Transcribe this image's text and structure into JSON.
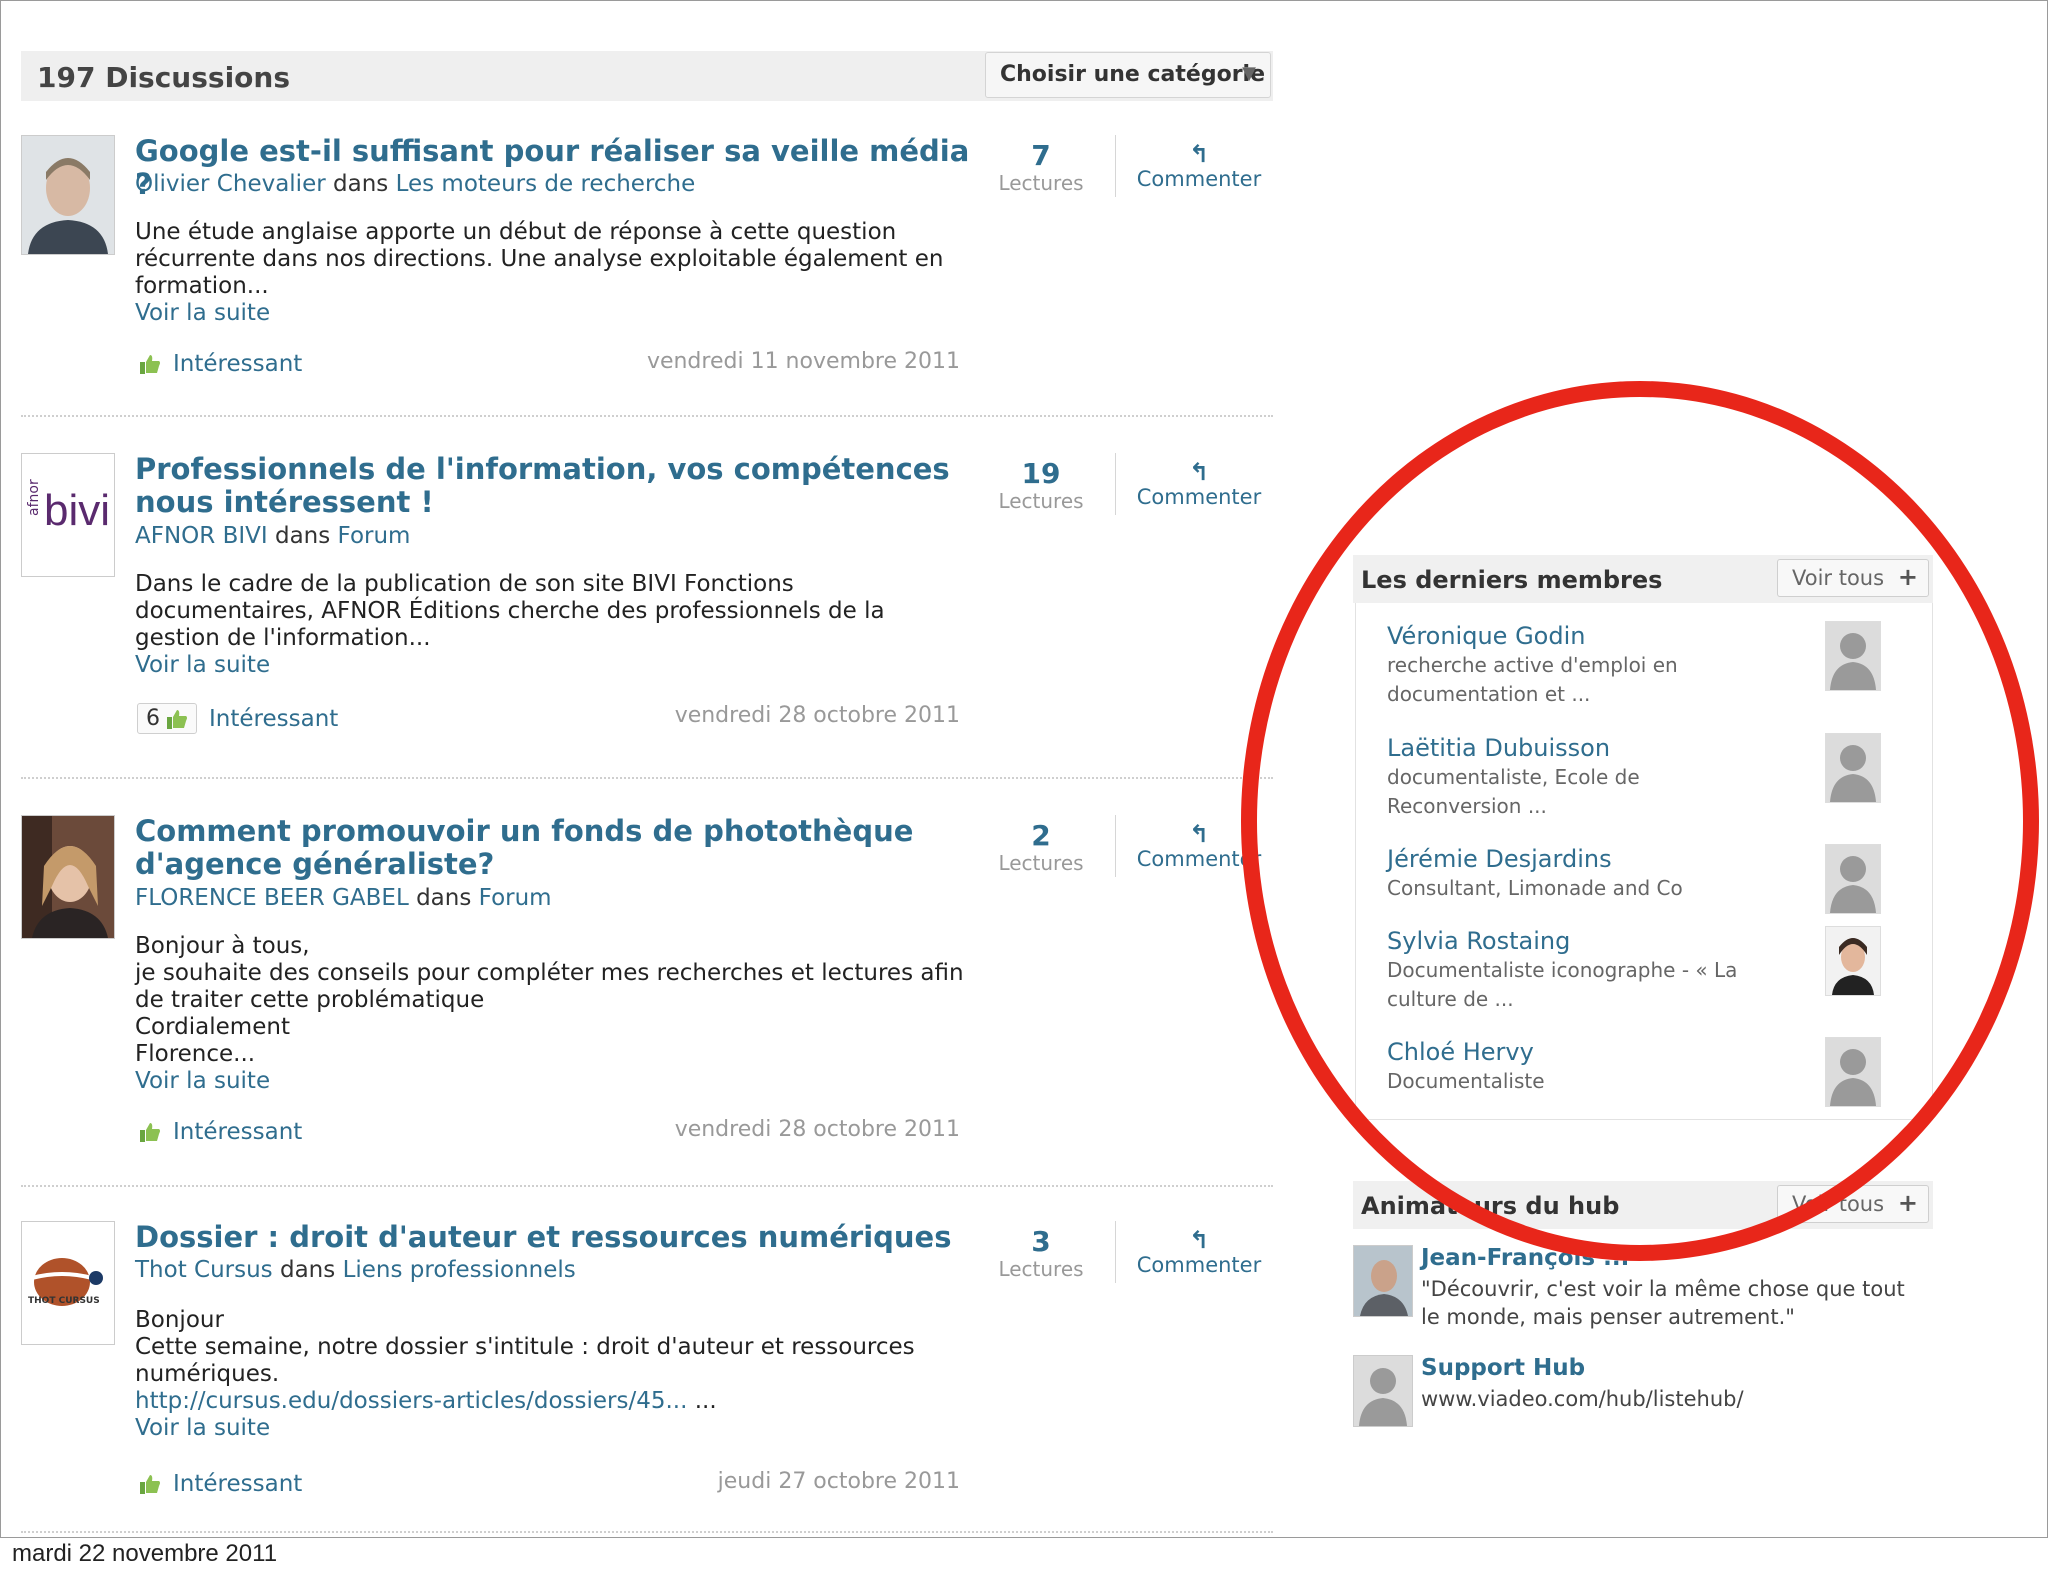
{
  "header": {
    "count_label": "197 Discussions",
    "category_button": "Choisir une catégorie",
    "dropdown_arrow": "▼"
  },
  "posts": [
    {
      "title": "Google est-il suffisant pour réaliser sa veille média ?",
      "author": "Olivier Chevalier",
      "dans": "dans",
      "category": "Les moteurs de recherche",
      "excerpt": [
        "Une étude anglaise apporte un début de réponse à cette question",
        "récurrente dans nos directions. Une analyse exploitable également en",
        "formation..."
      ],
      "read_more": "Voir la suite",
      "likes": "",
      "like_label": "Intéressant",
      "date": "vendredi 11 novembre 2011",
      "reads": "7",
      "reads_label": "Lectures",
      "comment_label": "Commenter",
      "comment_icon": "↰"
    },
    {
      "title": "Professionnels de l'information, vos compétences nous intéressent !",
      "author": "AFNOR BIVI",
      "dans": "dans",
      "category": "Forum",
      "excerpt": [
        "Dans le cadre de la publication de son site BIVI Fonctions",
        "documentaires, AFNOR Éditions cherche des professionnels de la",
        "gestion de l'information..."
      ],
      "read_more": "Voir la suite",
      "likes": "6",
      "like_label": "Intéressant",
      "date": "vendredi 28 octobre 2011",
      "reads": "19",
      "reads_label": "Lectures",
      "comment_label": "Commenter",
      "comment_icon": "↰",
      "logo_prefix": "afnor",
      "logo_text": "bivi"
    },
    {
      "title": "Comment promouvoir un fonds de photothèque d'agence généraliste?",
      "author": "FLORENCE BEER GABEL",
      "dans": "dans",
      "category": "Forum",
      "excerpt": [
        "Bonjour à tous,",
        "je souhaite des conseils pour compléter mes recherches et lectures afin",
        "de traiter cette problématique",
        "Cordialement",
        "Florence..."
      ],
      "read_more": "Voir la suite",
      "likes": "",
      "like_label": "Intéressant",
      "date": "vendredi 28 octobre 2011",
      "reads": "2",
      "reads_label": "Lectures",
      "comment_label": "Commenter",
      "comment_icon": "↰"
    },
    {
      "title": "Dossier : droit d'auteur et ressources numériques",
      "author": "Thot Cursus",
      "dans": "dans",
      "category": "Liens professionnels",
      "excerpt": [
        "Bonjour",
        "Cette semaine, notre dossier s'intitule : droit d'auteur et ressources",
        "numériques."
      ],
      "link": "http://cursus.edu/dossiers-articles/dossiers/45...",
      "link_suffix": " ...",
      "read_more": "Voir la suite",
      "likes": "",
      "like_label": "Intéressant",
      "date": "jeudi 27 octobre 2011",
      "reads": "3",
      "reads_label": "Lectures",
      "comment_label": "Commenter",
      "comment_icon": "↰",
      "logo_text": "THOT CURSUS"
    }
  ],
  "members": {
    "title": "Les derniers membres",
    "see_all": "Voir tous",
    "plus": "+",
    "items": [
      {
        "name": "Véronique Godin",
        "desc": "recherche active d'emploi en documentation et ..."
      },
      {
        "name": "Laëtitia Dubuisson",
        "desc": "documentaliste, Ecole de Reconversion ..."
      },
      {
        "name": "Jérémie Desjardins",
        "desc": "Consultant, Limonade and Co"
      },
      {
        "name": "Sylvia Rostaing",
        "desc": "Documentaliste iconographe - « La culture de ..."
      },
      {
        "name": "Chloé Hervy",
        "desc": "Documentaliste"
      }
    ]
  },
  "animators": {
    "title": "Animateurs du hub",
    "see_all": "Voir tous",
    "plus": "+",
    "items": [
      {
        "name": "Jean-François ...",
        "text": "\"Découvrir, c'est voir la même chose que tout le monde, mais penser autrement.\""
      },
      {
        "name": "Support Hub",
        "text": "www.viadeo.com/hub/listehub/"
      }
    ]
  },
  "footer": {
    "date": "mardi 22 novembre 2011"
  },
  "colors": {
    "link": "#2f6d8e",
    "annotation": "#e8261a"
  }
}
